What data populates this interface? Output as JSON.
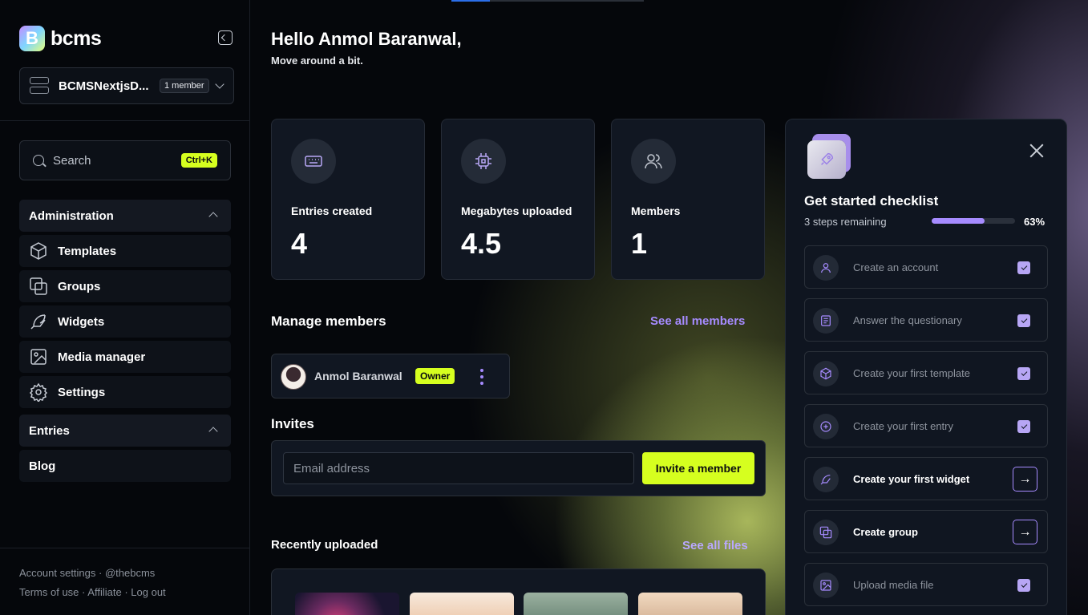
{
  "app": {
    "name": "bcms",
    "logo_letter": "B"
  },
  "workspace": {
    "name": "BCMSNextjsD...",
    "members_badge": "1 member"
  },
  "search": {
    "label": "Search",
    "shortcut": "Ctrl+K"
  },
  "sidebar": {
    "sections": [
      {
        "label": "Administration",
        "items": [
          {
            "label": "Templates",
            "icon": "cube-icon"
          },
          {
            "label": "Groups",
            "icon": "groups-icon"
          },
          {
            "label": "Widgets",
            "icon": "feather-icon"
          },
          {
            "label": "Media manager",
            "icon": "image-icon"
          },
          {
            "label": "Settings",
            "icon": "gear-icon"
          }
        ]
      },
      {
        "label": "Entries",
        "items": [
          {
            "label": "Blog"
          }
        ]
      }
    ],
    "footer": {
      "account_settings": "Account settings",
      "handle": "@thebcms",
      "terms": "Terms of use",
      "affiliate": "Affiliate",
      "logout": "Log out",
      "sep": "·"
    }
  },
  "greeting": {
    "title": "Hello Anmol Baranwal,",
    "subtitle": "Move around a bit."
  },
  "stats": [
    {
      "label": "Entries created",
      "value": "4",
      "icon": "keyboard-icon"
    },
    {
      "label": "Megabytes uploaded",
      "value": "4.5",
      "icon": "chip-icon"
    },
    {
      "label": "Members",
      "value": "1",
      "icon": "users-icon"
    }
  ],
  "members": {
    "title": "Manage members",
    "see_all": "See all members",
    "list": [
      {
        "name": "Anmol Baranwal",
        "role": "Owner"
      }
    ]
  },
  "invites": {
    "title": "Invites",
    "email_placeholder": "Email address",
    "button": "Invite a member"
  },
  "recent": {
    "title": "Recently uploaded",
    "see_all": "See all files",
    "thumbnails": 4
  },
  "checklist": {
    "title": "Get started checklist",
    "steps_remaining": "3 steps remaining",
    "progress": 0.63,
    "progress_label": "63%",
    "items": [
      {
        "label": "Create an account",
        "done": true,
        "icon": "user-icon"
      },
      {
        "label": "Answer the questionary",
        "done": true,
        "icon": "form-icon"
      },
      {
        "label": "Create your first template",
        "done": true,
        "icon": "cube-icon"
      },
      {
        "label": "Create your first entry",
        "done": true,
        "icon": "plus-circle-icon"
      },
      {
        "label": "Create your first widget",
        "done": false,
        "icon": "feather-icon"
      },
      {
        "label": "Create group",
        "done": false,
        "icon": "groups-icon"
      },
      {
        "label": "Upload media file",
        "done": true,
        "icon": "image-icon"
      }
    ]
  },
  "colors": {
    "accent": "#d6ff1f",
    "purple": "#a68bff",
    "panel": "#111722",
    "bg": "#05070b"
  }
}
